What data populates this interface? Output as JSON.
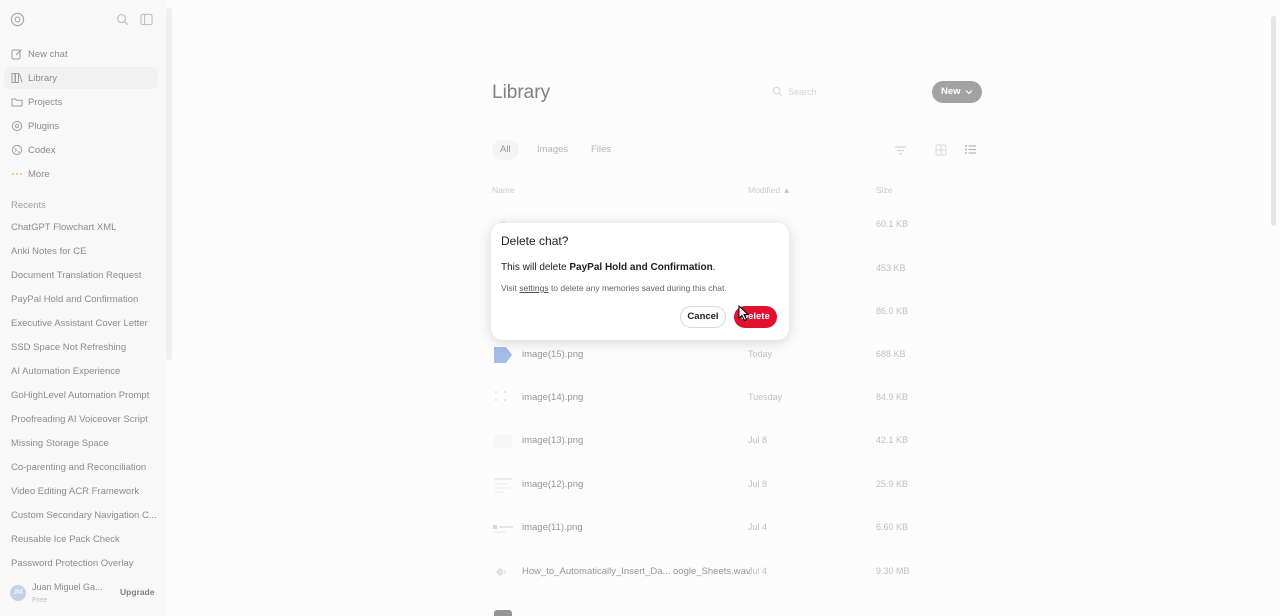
{
  "sidebar": {
    "nav": [
      {
        "label": "New chat",
        "icon": "edit-icon"
      },
      {
        "label": "Library",
        "icon": "library-icon"
      },
      {
        "label": "Projects",
        "icon": "folder-icon"
      },
      {
        "label": "Plugins",
        "icon": "plugins-icon"
      },
      {
        "label": "Codex",
        "icon": "codex-icon"
      },
      {
        "label": "More",
        "icon": "more-icon"
      }
    ],
    "recents_title": "Recents",
    "recents": [
      "ChatGPT Flowchart XML",
      "Anki Notes for CE",
      "Document Translation Request",
      "PayPal Hold and Confirmation",
      "Executive Assistant Cover Letter",
      "SSD Space Not Refreshing",
      "AI Automation Experience",
      "GoHighLevel Automation Prompt",
      "Proofreading AI Voiceover Script",
      "Missing Storage Space",
      "Co-parenting and Reconciliation",
      "Video Editing ACR Framework",
      "Custom Secondary Navigation C...",
      "Reusable Ice Pack Check",
      "Password Protection Overlay"
    ],
    "user": {
      "name": "Juan Miguel Ga...",
      "plan": "Free",
      "initials": "JM",
      "upgrade_label": "Upgrade"
    }
  },
  "library": {
    "title": "Library",
    "search_placeholder": "Search",
    "new_label": "New",
    "tabs": [
      "All",
      "Images",
      "Files"
    ],
    "columns": {
      "name": "Name",
      "modified": "Modified",
      "size": "Size"
    },
    "rows": [
      {
        "name": "",
        "modified": "",
        "size": "60.1 KB"
      },
      {
        "name": "",
        "modified": "",
        "size": "453 KB"
      },
      {
        "name": "",
        "modified": "",
        "size": "86.0 KB"
      },
      {
        "name": "image(15).png",
        "modified": "Today",
        "size": "688 KB"
      },
      {
        "name": "image(14).png",
        "modified": "Tuesday",
        "size": "84.9 KB"
      },
      {
        "name": "image(13).png",
        "modified": "Jul 8",
        "size": "42.1 KB"
      },
      {
        "name": "image(12).png",
        "modified": "Jul 8",
        "size": "25.9 KB"
      },
      {
        "name": "image(11).png",
        "modified": "Jul 4",
        "size": "6.60 KB"
      },
      {
        "name": "How_to_Automatically_Insert_Da... oogle_Sheets.wav",
        "modified": "Jul 4",
        "size": "9.30 MB"
      }
    ]
  },
  "dialog": {
    "title": "Delete chat?",
    "message_prefix": "This will delete ",
    "chat_name": "PayPal Hold and Confirmation",
    "message_suffix": ".",
    "note_prefix": "Visit ",
    "note_link": "settings",
    "note_suffix": " to delete any memories saved during this chat.",
    "cancel_label": "Cancel",
    "delete_label": "Delete"
  },
  "colors": {
    "delete_red": "#e0102e",
    "new_button": "#6b6b6b"
  }
}
